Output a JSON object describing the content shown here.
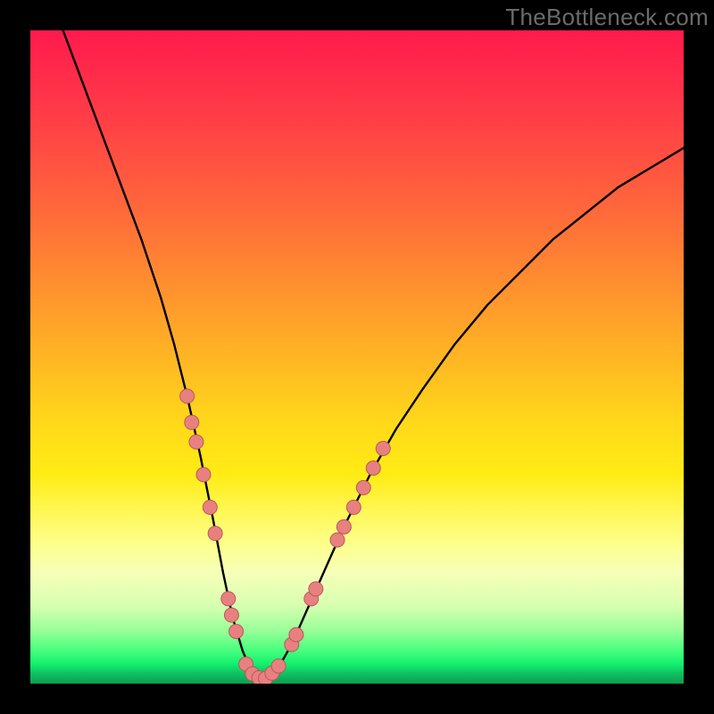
{
  "watermark": "TheBottleneck.com",
  "chart_data": {
    "type": "line",
    "title": "",
    "xlabel": "",
    "ylabel": "",
    "xlim": [
      0,
      100
    ],
    "ylim": [
      0,
      100
    ],
    "series": [
      {
        "name": "bottleneck-curve",
        "x": [
          5,
          8,
          11,
          14,
          17,
          20,
          22,
          24,
          26,
          28,
          29.5,
          31,
          32.5,
          34,
          36,
          38,
          40,
          44,
          48,
          52,
          56,
          60,
          65,
          70,
          75,
          80,
          85,
          90,
          95,
          100
        ],
        "y": [
          100,
          92,
          84,
          76,
          68,
          59,
          52,
          44,
          35,
          25,
          17,
          10,
          5,
          1.5,
          0.8,
          2.5,
          6,
          15,
          24,
          32,
          39,
          45,
          52,
          58,
          63,
          68,
          72,
          76,
          79,
          82
        ]
      }
    ],
    "markers": {
      "name": "curve-points",
      "points": [
        {
          "x": 24.0,
          "y": 44
        },
        {
          "x": 24.7,
          "y": 40
        },
        {
          "x": 25.4,
          "y": 37
        },
        {
          "x": 26.5,
          "y": 32
        },
        {
          "x": 27.5,
          "y": 27
        },
        {
          "x": 28.3,
          "y": 23
        },
        {
          "x": 30.3,
          "y": 13
        },
        {
          "x": 30.8,
          "y": 10.5
        },
        {
          "x": 31.5,
          "y": 8
        },
        {
          "x": 33.0,
          "y": 3
        },
        {
          "x": 34.0,
          "y": 1.5
        },
        {
          "x": 35.0,
          "y": 0.9
        },
        {
          "x": 36.0,
          "y": 0.8
        },
        {
          "x": 37.0,
          "y": 1.6
        },
        {
          "x": 38.0,
          "y": 2.7
        },
        {
          "x": 40.0,
          "y": 6.0
        },
        {
          "x": 40.7,
          "y": 7.5
        },
        {
          "x": 43.0,
          "y": 13
        },
        {
          "x": 43.7,
          "y": 14.5
        },
        {
          "x": 47.0,
          "y": 22
        },
        {
          "x": 48.0,
          "y": 24
        },
        {
          "x": 49.5,
          "y": 27
        },
        {
          "x": 51.0,
          "y": 30
        },
        {
          "x": 52.5,
          "y": 33
        },
        {
          "x": 54.0,
          "y": 36
        }
      ]
    },
    "marker_style": {
      "fill": "#e98080",
      "stroke": "#b55a5a",
      "r": 8
    }
  }
}
